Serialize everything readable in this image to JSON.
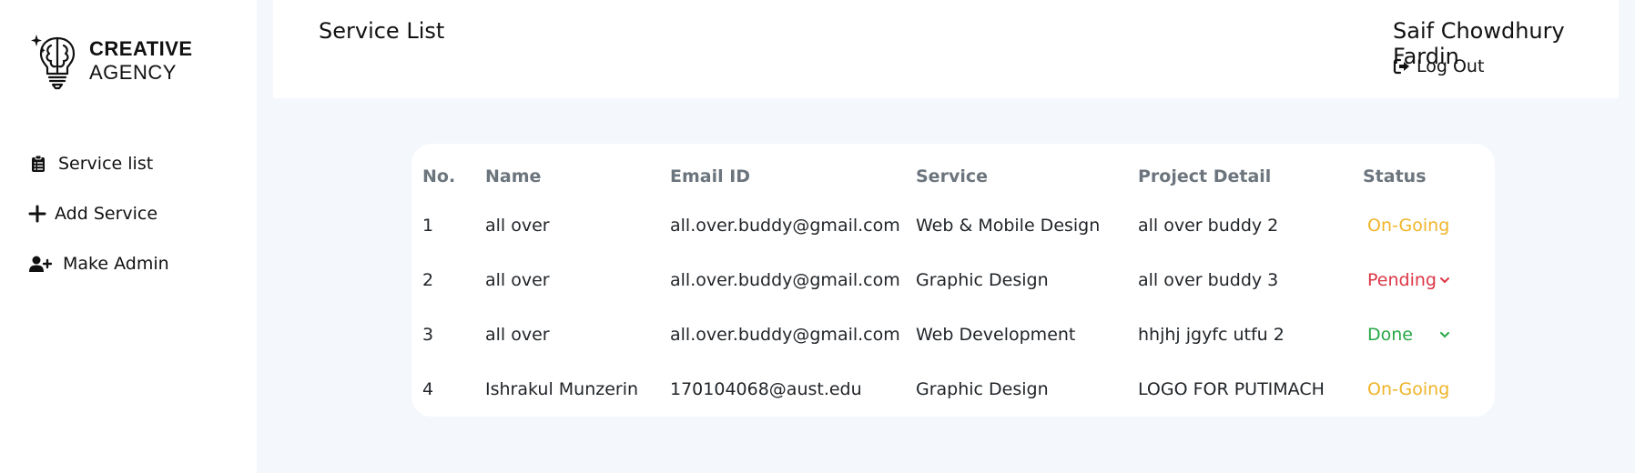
{
  "brand": {
    "line1": "CREATIVE",
    "line2": "AGENCY"
  },
  "sidebar": {
    "items": [
      {
        "label": "Service list",
        "icon": "clipboard-list-icon"
      },
      {
        "label": "Add Service",
        "icon": "plus-icon"
      },
      {
        "label": "Make Admin",
        "icon": "user-plus-icon"
      }
    ]
  },
  "header": {
    "title": "Service List",
    "user_name": "Saif Chowdhury Fardin",
    "logout_label": "Log Out"
  },
  "table": {
    "columns": [
      "No.",
      "Name",
      "Email ID",
      "Service",
      "Project Detail",
      "Status"
    ],
    "rows": [
      {
        "no": "1",
        "name": "all over",
        "email": "all.over.buddy@gmail.com",
        "service": "Web & Mobile Design",
        "detail": "all over buddy 2",
        "status": "On-Going"
      },
      {
        "no": "2",
        "name": "all over",
        "email": "all.over.buddy@gmail.com",
        "service": "Graphic Design",
        "detail": "all over buddy 3",
        "status": "Pending"
      },
      {
        "no": "3",
        "name": "all over",
        "email": "all.over.buddy@gmail.com",
        "service": "Web Development",
        "detail": "hhjhj jgyfc utfu 2",
        "status": "Done"
      },
      {
        "no": "4",
        "name": "Ishrakul Munzerin",
        "email": "170104068@aust.edu",
        "service": "Graphic Design",
        "detail": "LOGO FOR PUTIMACH",
        "status": "On-Going"
      }
    ]
  },
  "colors": {
    "main_bg": "#f4f7fc",
    "status_ongoing": "#f0b429",
    "status_pending": "#dc3545",
    "status_done": "#28a745"
  }
}
